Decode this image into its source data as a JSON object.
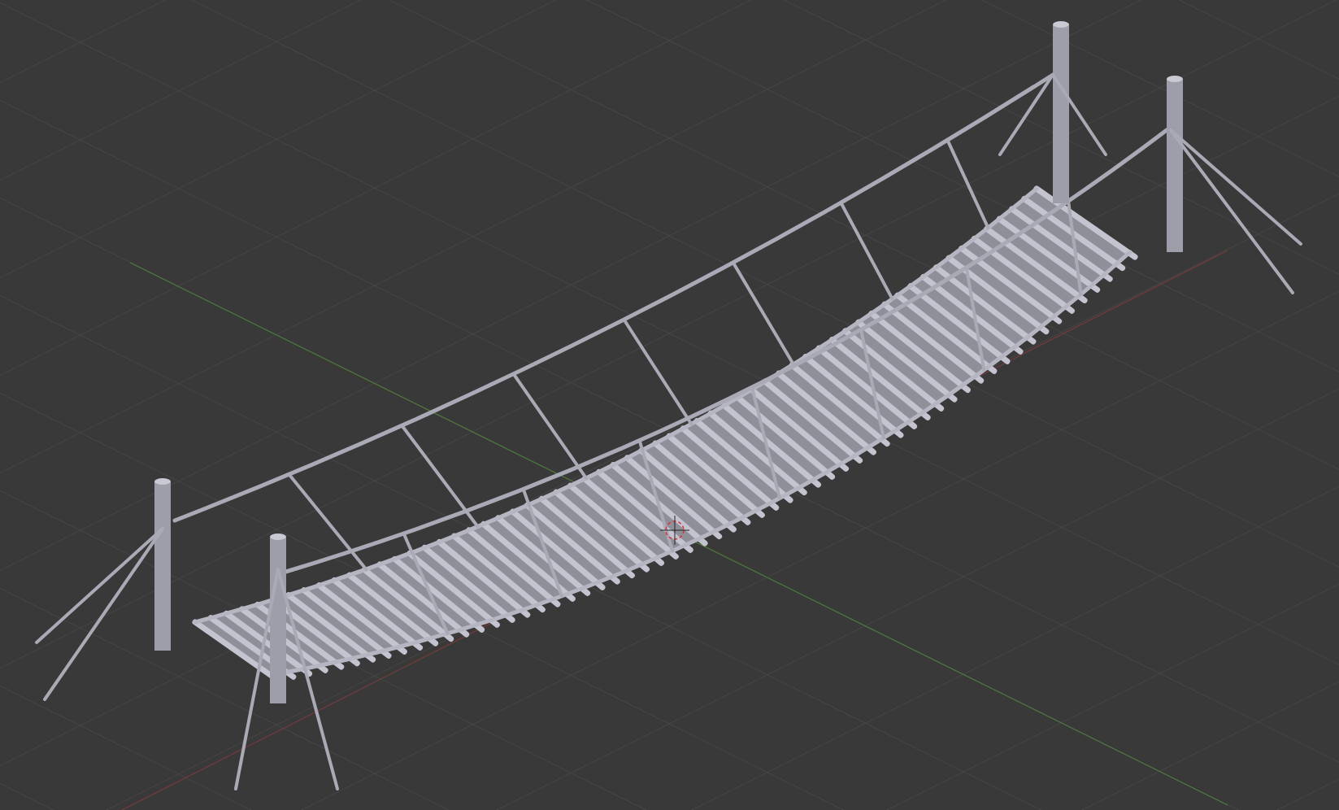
{
  "viewport": {
    "show_grid": true,
    "show_axes": true,
    "show_cursor": true,
    "show_model": true
  }
}
